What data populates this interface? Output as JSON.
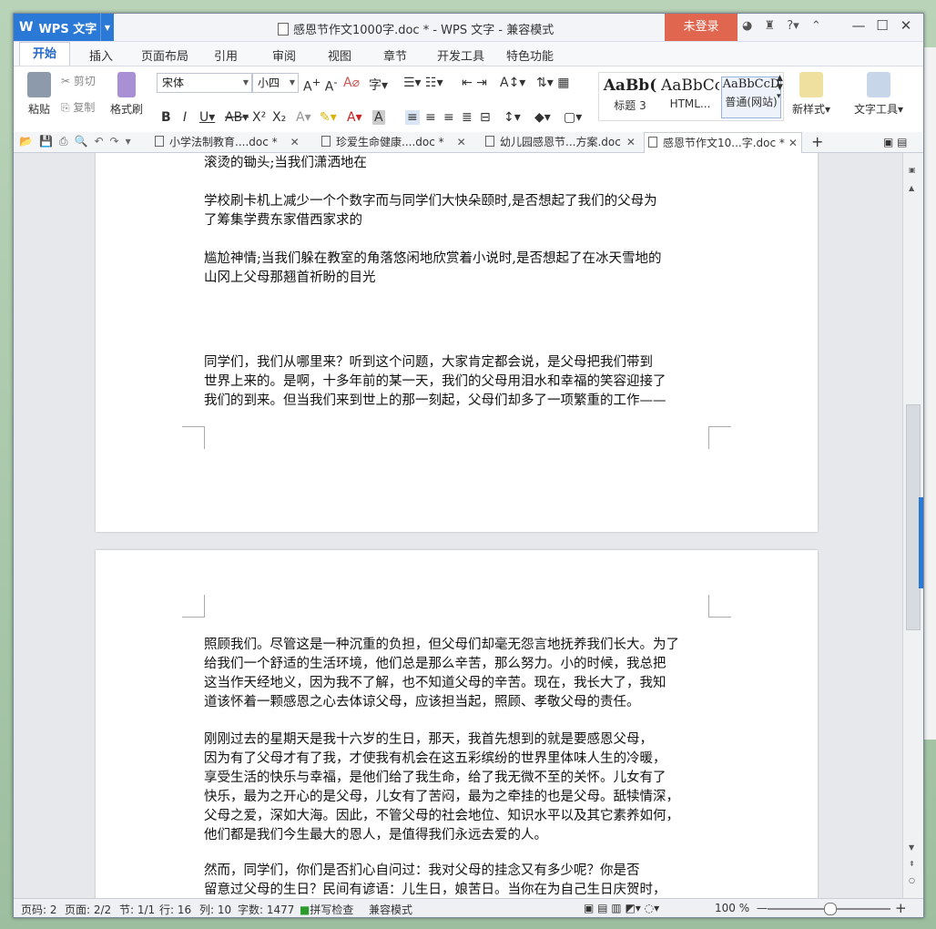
{
  "app": {
    "name": "WPS 文字",
    "logo": "W",
    "window_title": "感恩节作文1000字.doc * - WPS 文字 - 兼容模式",
    "login_label": "未登录"
  },
  "ribbon_tabs": [
    "开始",
    "插入",
    "页面布局",
    "引用",
    "审阅",
    "视图",
    "章节",
    "开发工具",
    "特色功能"
  ],
  "ribbon": {
    "paste": "粘贴",
    "cut": "剪切",
    "copy": "复制",
    "format_painter": "格式刷",
    "font_name": "宋体",
    "font_size": "小四",
    "styles": [
      {
        "preview": "AaBb(",
        "name": "标题 3"
      },
      {
        "preview": "AaBbCc",
        "name": "HTML..."
      },
      {
        "preview": "AaBbCcD",
        "name": "普通(网站)"
      }
    ],
    "new_style": "新样式",
    "text_tools": "文字工具"
  },
  "doc_tabs": [
    "小学法制教育....doc *",
    "珍爱生命健康....doc *",
    "幼儿园感恩节...方案.doc",
    "感恩节作文10...字.doc *"
  ],
  "page1": {
    "lines": [
      "滚烫的锄头;当我们潇洒地在",
      "学校刷卡机上减少一个个数字而与同学们大快朵颐时,是否想起了我们的父母为\n了筹集学费东家借西家求的",
      "尴尬神情;当我们躲在教室的角落悠闲地欣赏着小说时,是否想起了在冰天雪地的\n山冈上父母那翘首祈盼的目光",
      "    同学们，我们从哪里来？听到这个问题，大家肯定都会说，是父母把我们带到\n世界上来的。是啊，十多年前的某一天，我们的父母用泪水和幸福的笑容迎接了\n我们的到来。但当我们来到世上的那一刻起，父母们却多了一项繁重的工作——"
    ]
  },
  "page2": {
    "paras": [
      "照顾我们。尽管这是一种沉重的负担，但父母们却毫无怨言地抚养我们长大。为了\n给我们一个舒适的生活环境，他们总是那么辛苦，那么努力。小的时候，我总把\n这当作天经地义，因为我不了解，也不知道父母的辛苦。现在，我长大了，我知\n道该怀着一颗感恩之心去体谅父母，应该担当起，照顾、孝敬父母的责任。",
      "    刚刚过去的星期天是我十六岁的生日，那天，我首先想到的就是要感恩父母，\n因为有了父母才有了我，才使我有机会在这五彩缤纷的世界里体味人生的冷暖，\n享受生活的快乐与幸福，是他们给了我生命，给了我无微不至的关怀。儿女有了\n快乐，最为之开心的是父母，儿女有了苦闷，最为之牵挂的也是父母。舐犊情深，\n父母之爱，深如大海。因此，不管父母的社会地位、知识水平以及其它素养如何，\n他们都是我们今生最大的恩人，是值得我们永远去爱的人。",
      "    然而，同学们，你们是否扪心自问过：我对父母的挂念又有多少呢？你是否\n留意过父母的生日？民间有谚语：儿生日，娘苦日。当你在为自己生日庆贺时，\n你是否想到过用死亡般的痛苦，让你降生的母亲呢？是否曾真诚地给孕育你生命"
    ]
  },
  "status": {
    "page_code": "页码: 2",
    "pages": "页面: 2/2",
    "section": "节: 1/1",
    "row": "行: 16",
    "col": "列: 10",
    "words": "字数: 1477",
    "spell": "拼写检查",
    "mode": "兼容模式",
    "zoom": "100 %"
  },
  "colors": {
    "accent": "#2b79d7",
    "login": "#e0664f"
  }
}
